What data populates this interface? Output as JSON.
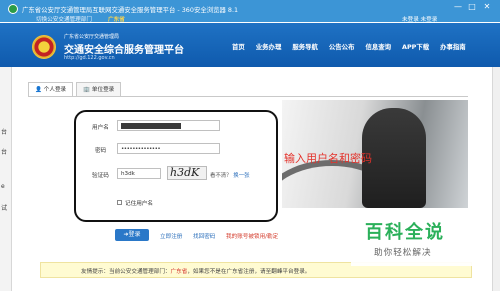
{
  "browser": {
    "title": "广东省公安厅交通管理局互联网交通安全服务管理平台 - 360安全浏览器 8.1",
    "tab_label": "切换公安交通管理部门",
    "tab_region": "广东省",
    "login_links": "未登录   未登录",
    "minimize": "—",
    "maximize": "□",
    "close": "✕"
  },
  "header": {
    "sup": "广东省公安厅交通管理局",
    "title": "交通安全综合服务管理平台",
    "url": "http://gd.122.gov.cn",
    "nav": [
      "首页",
      "业务办理",
      "服务导航",
      "公告公布",
      "信息查询",
      "APP下载",
      "办事指南"
    ]
  },
  "left_rail": [
    "台",
    "台",
    "e",
    "试"
  ],
  "tabs": [
    {
      "label": "个人登录",
      "active": true
    },
    {
      "label": "单位登录",
      "active": false
    }
  ],
  "form": {
    "username_label": "用户名",
    "password_label": "密码",
    "password_value": "••••••••••••••",
    "captcha_label": "验证码",
    "captcha_value": "h3dk",
    "captcha_image_text": "h3dK",
    "captcha_hint": "看不清？",
    "captcha_refresh": "换一张",
    "remember_label": "记住用户名"
  },
  "actions": {
    "login": "登录",
    "register": "立即注册",
    "forgot": "找回密码",
    "locked": "我的账号被锁用/勒定"
  },
  "overlay_instruction": "输入用户名和密码",
  "notice": {
    "prefix": "友情提示：当前公安交通管理部门：",
    "region": "广东省",
    "suffix": "，如果您不是在广东省注册，请至翻峰平台登录。"
  },
  "watermark": {
    "title": "百科全说",
    "subtitle": "助你轻松解决"
  },
  "colors": {
    "header_blue": "#1f72c4",
    "accent_red": "#e4322b",
    "watermark_green": "#2bb05a",
    "button_blue": "#2a78c8"
  }
}
